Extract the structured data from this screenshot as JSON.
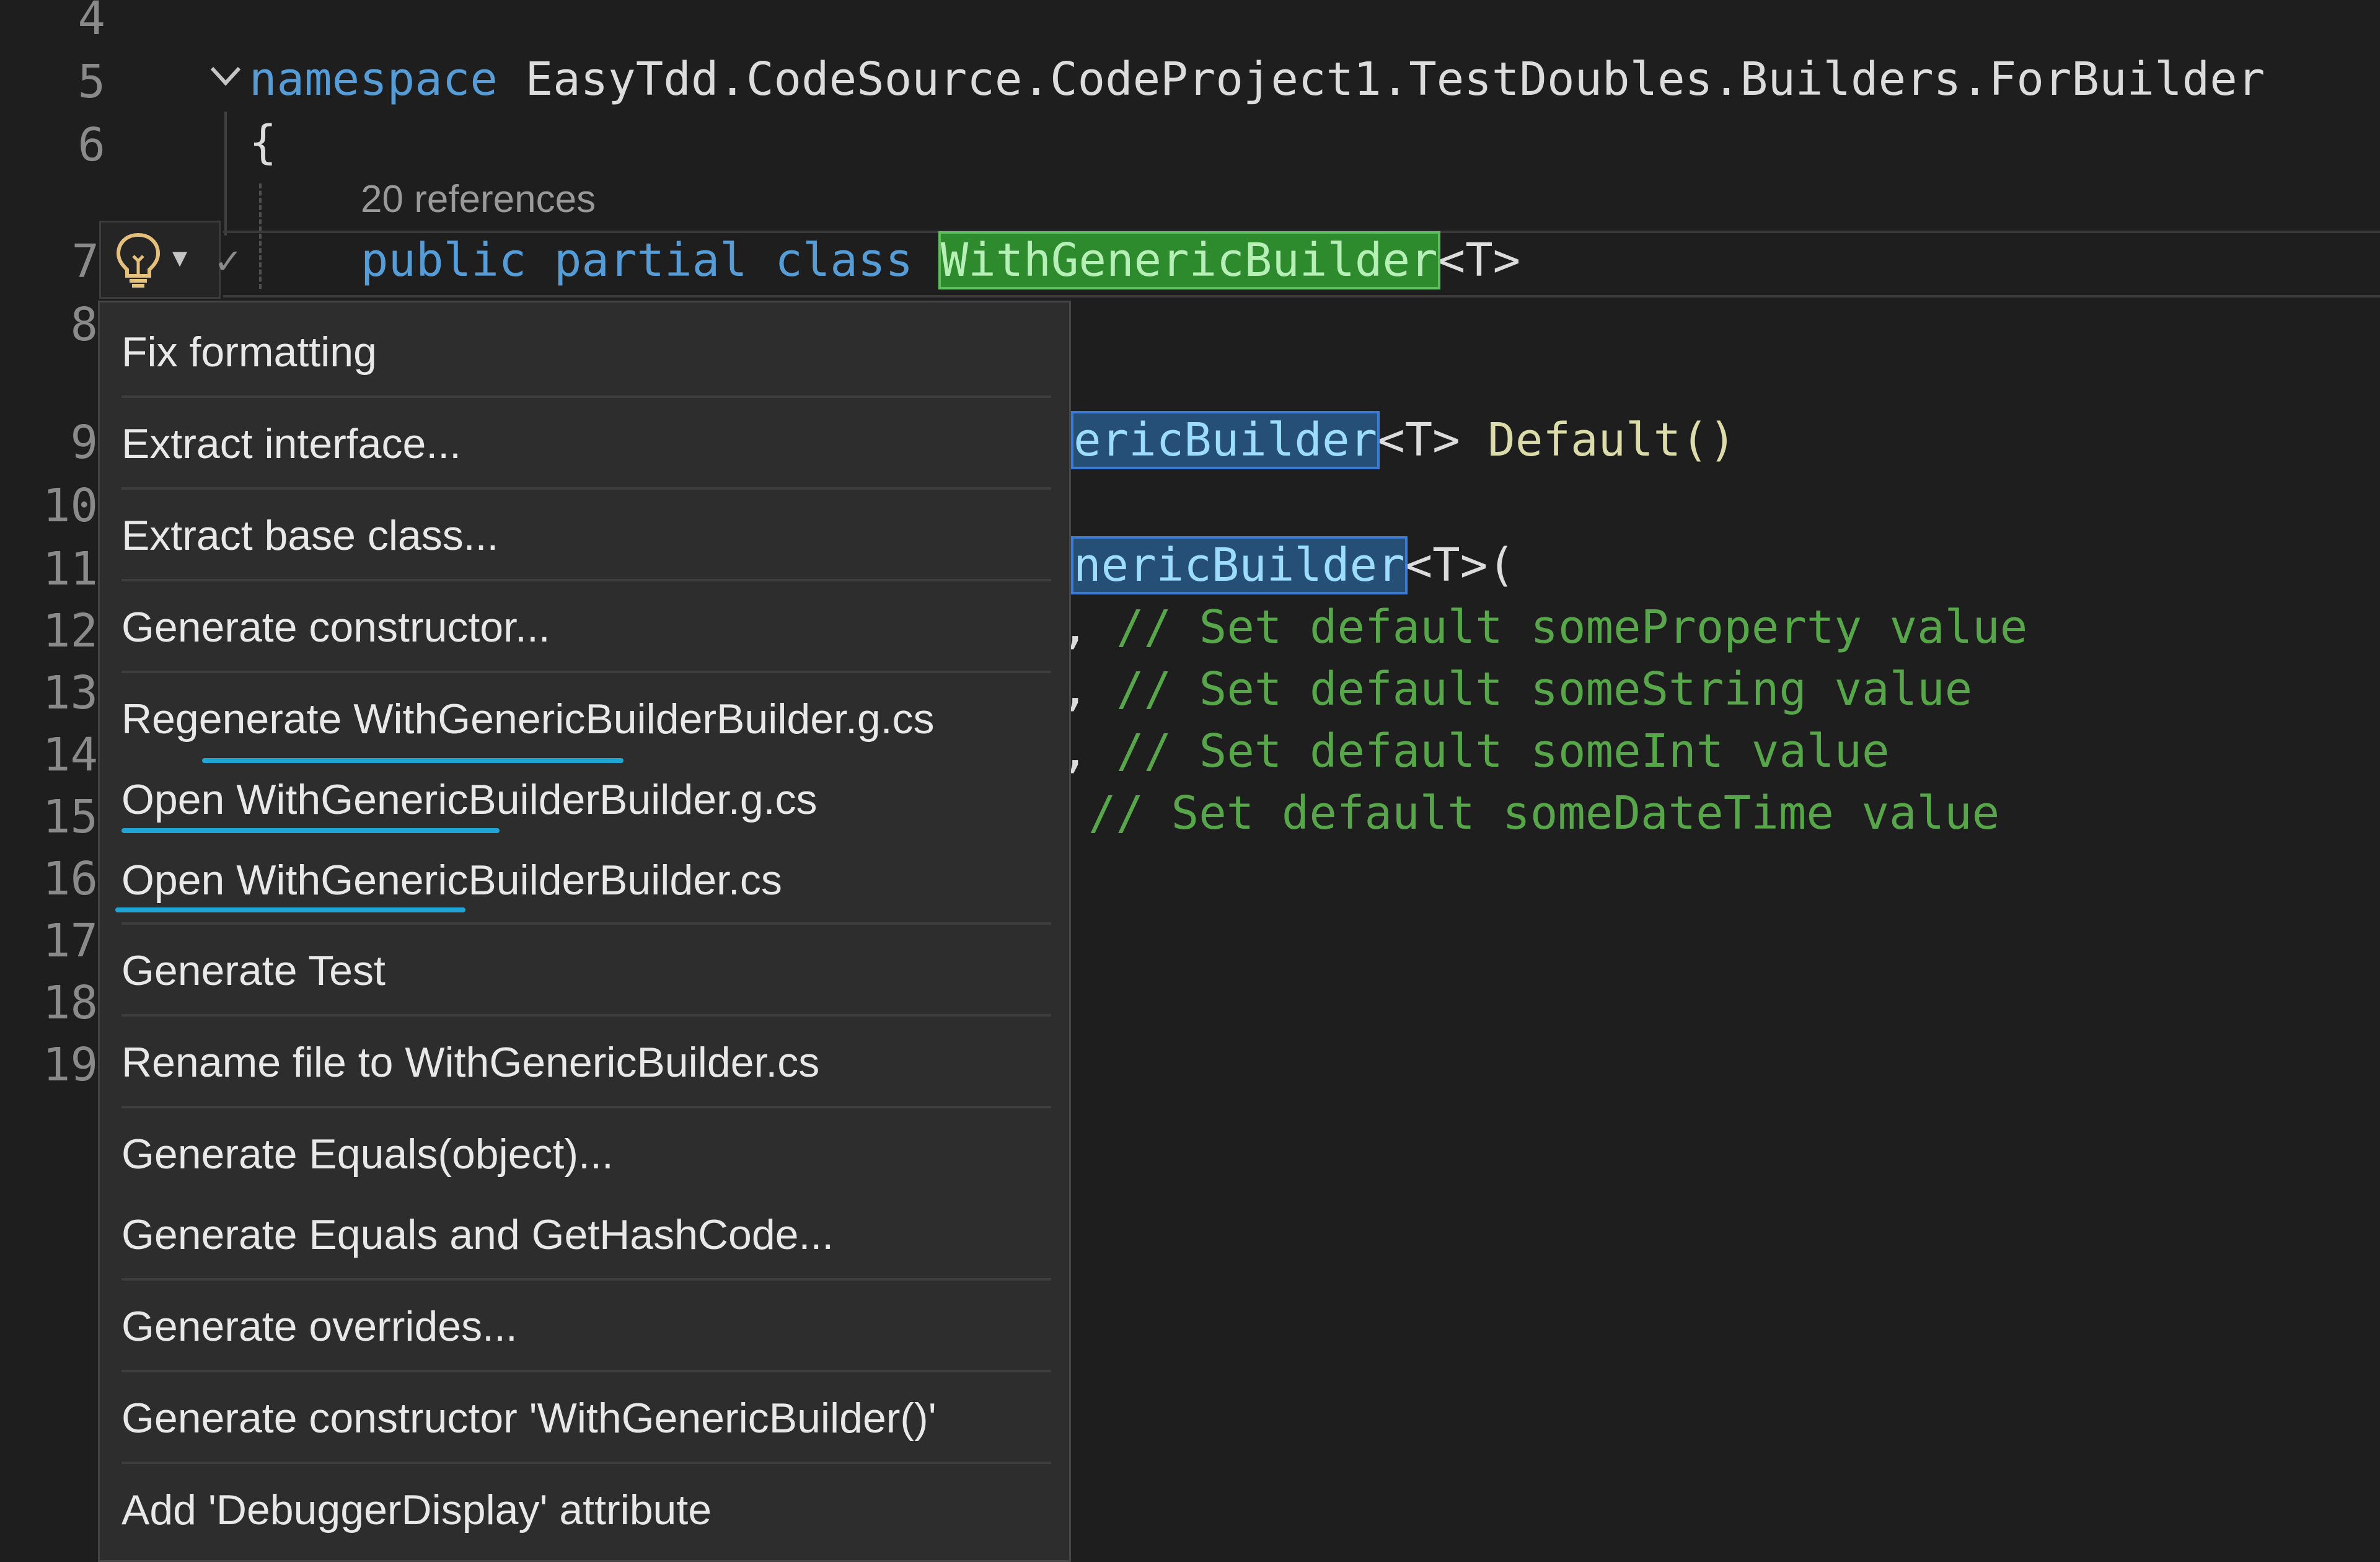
{
  "gutter": {
    "lines": [
      "4",
      "5",
      "6",
      "7",
      "8",
      "9",
      "10",
      "11",
      "12",
      "13",
      "14",
      "15",
      "16",
      "17",
      "18",
      "19"
    ]
  },
  "code": {
    "line5_keyword": "namespace",
    "line5_name": "EasyTdd.CodeSource.CodeProject1.TestDoubles.Builders.ForBuilder",
    "line6_brace": "{",
    "codelens": "20 references",
    "line7_kw1": "public",
    "line7_kw2": "partial",
    "line7_kw3": "class",
    "line7_class": "WithGenericBuilder",
    "line7_generic": "<T>",
    "line9_partial": "ericBuilder",
    "line9_rest_generic": "<T>",
    "line9_method": "Default()",
    "line11_partial": "nericBuilder",
    "line11_rest": "<T>(",
    "comment12": "// Set default someProperty value",
    "comment13": "// Set default someString value",
    "comment14": "// Set default someInt value",
    "comment15": "// Set default someDateTime value",
    "comma": ","
  },
  "menu": {
    "items": [
      "Fix formatting",
      "Extract interface...",
      "Extract base class...",
      "Generate constructor...",
      "Regenerate WithGenericBuilderBuilder.g.cs",
      "Open WithGenericBuilderBuilder.g.cs",
      "Open WithGenericBuilderBuilder.cs",
      "Generate Test",
      "Rename file to WithGenericBuilder.cs",
      "Generate Equals(object)...",
      "Generate Equals and GetHashCode...",
      "Generate overrides...",
      "Generate constructor 'WithGenericBuilder()'",
      "Add 'DebuggerDisplay' attribute"
    ]
  },
  "colors": {
    "background": "#1e1e1e",
    "keyword": "#569cd6",
    "class": "#4ec9b0",
    "comment": "#57a64a",
    "underline": "#1fa4d6"
  },
  "icons": [
    "lightbulb-icon",
    "chevron-down-icon",
    "fold-chevron-icon",
    "check-icon"
  ]
}
